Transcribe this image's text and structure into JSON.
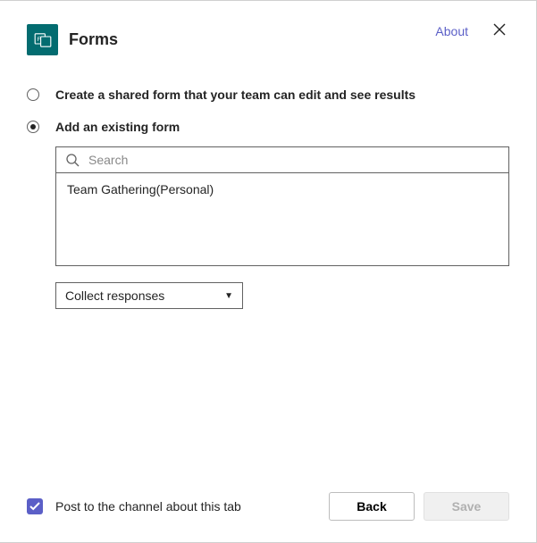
{
  "header": {
    "title": "Forms",
    "about_label": "About"
  },
  "options": {
    "create_label": "Create a shared form that your team can edit and see results",
    "add_label": "Add an existing form"
  },
  "search": {
    "placeholder": "Search",
    "value": ""
  },
  "form_list": [
    {
      "label": "Team Gathering(Personal)"
    }
  ],
  "dropdown": {
    "selected": "Collect responses"
  },
  "footer": {
    "post_label": "Post to the channel about this tab",
    "back_label": "Back",
    "save_label": "Save"
  }
}
